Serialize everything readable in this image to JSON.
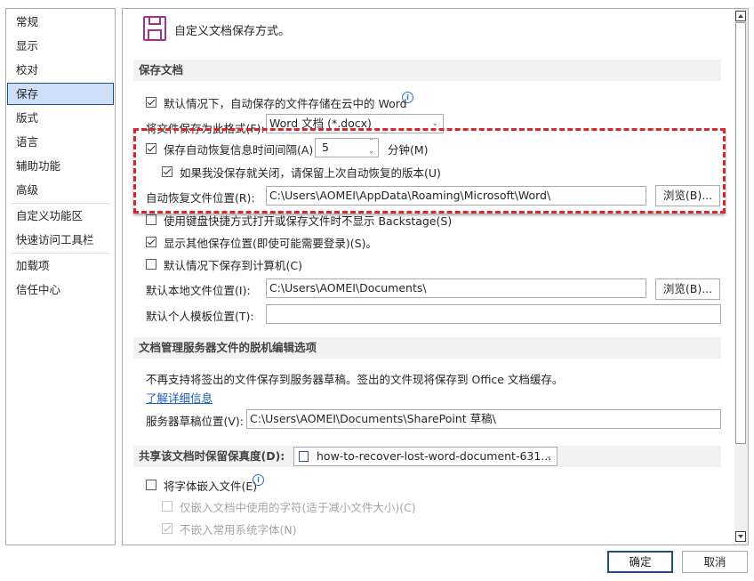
{
  "nav": {
    "items": [
      {
        "label": "常规"
      },
      {
        "label": "显示"
      },
      {
        "label": "校对"
      },
      {
        "label": "保存"
      },
      {
        "label": "版式"
      },
      {
        "label": "语言"
      },
      {
        "label": "辅助功能"
      },
      {
        "label": "高级"
      },
      {
        "label": "自定义功能区"
      },
      {
        "label": "快速访问工具栏"
      },
      {
        "label": "加载项"
      },
      {
        "label": "信任中心"
      }
    ],
    "selected": "保存"
  },
  "header": {
    "title": "自定义文档保存方式。",
    "icon": "save-floppy-icon"
  },
  "save_section": {
    "title": "保存文档",
    "cloud_default": "默认情况下，自动保存的文件存储在云中的 Word",
    "format_label": "将文件保存为此格式(F):",
    "format_value": "Word 文档 (*.docx)",
    "autorecover_label": "保存自动恢复信息时间间隔(A)",
    "autorecover_minutes": "5",
    "minutes_unit": "分钟(M)",
    "keep_last_label": "如果我没保存就关闭，请保留上次自动恢复的版本(U)",
    "autorecover_location_label": "自动恢复文件位置(R):",
    "autorecover_location_value": "C:\\Users\\AOMEI\\AppData\\Roaming\\Microsoft\\Word\\",
    "browse_label": "浏览(B)...",
    "no_backstage_label": "使用键盘快捷方式打开或保存文件时不显示 Backstage(S)",
    "show_more_label": "显示其他保存位置(即使可能需要登录)(S)。",
    "save_to_computer_label": "默认情况下保存到计算机(C)",
    "local_location_label": "默认本地文件位置(I):",
    "local_location_value": "C:\\Users\\AOMEI\\Documents\\",
    "browse2_label": "浏览(B)...",
    "template_location_label": "默认个人模板位置(T):",
    "template_location_value": ""
  },
  "offline_section": {
    "title": "文档管理服务器文件的脱机编辑选项",
    "description": "不再支持将签出的文件保存到服务器草稿。签出的文件现将保存到 Office 文档缓存。",
    "learn_more": "了解详细信息",
    "drafts_label": "服务器草稿位置(V):",
    "drafts_value": "C:\\Users\\AOMEI\\Documents\\SharePoint 草稿\\"
  },
  "fidelity_section": {
    "title": "共享该文档时保留保真度(D):",
    "document_name": "how-to-recover-lost-word-document-631...",
    "embed_fonts_label": "将字体嵌入文件(E)",
    "only_used_chars_label": "仅嵌入文档中使用的字符(适于减小文件大小)(C)",
    "no_common_fonts_label": "不嵌入常用系统字体(N)"
  },
  "dialog": {
    "ok_label": "确定",
    "cancel_label": "取消"
  },
  "checkbox_states": {
    "cloud_default": true,
    "autorecover": true,
    "keep_last": true,
    "no_backstage": false,
    "show_more": true,
    "save_to_computer": false,
    "embed_fonts": false,
    "only_used_chars": false,
    "no_common_fonts": true
  },
  "colors": {
    "highlight_box": "#d8252b",
    "selected_nav": "#cde0f7",
    "accent": "#1c4e8a",
    "save_icon": "#a0338a"
  }
}
